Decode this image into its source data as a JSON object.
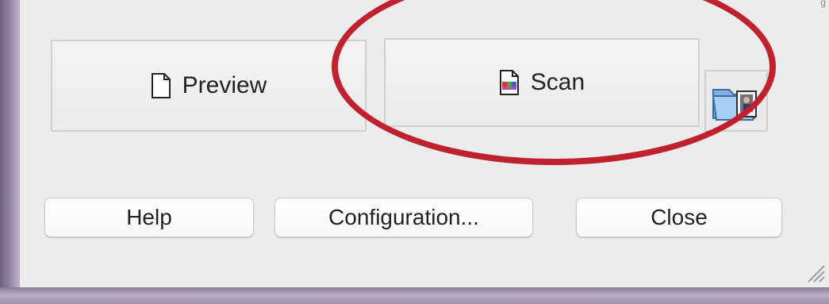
{
  "window": {
    "top_right_text": "g"
  },
  "buttons": {
    "preview_label": "Preview",
    "scan_label": "Scan",
    "help_label": "Help",
    "configuration_label": "Configuration...",
    "close_label": "Close"
  },
  "icons": {
    "preview": "document-icon",
    "scan": "scan-document-icon",
    "folder": "image-folder-icon",
    "resize": "resize-grip-icon"
  },
  "colors": {
    "highlight": "#c0212f",
    "dialog_bg": "#ececec"
  }
}
